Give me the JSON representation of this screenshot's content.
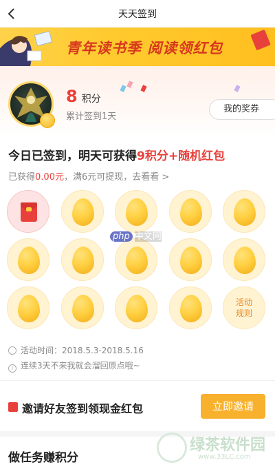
{
  "header": {
    "title": "天天签到"
  },
  "banner": {
    "text": "青年读书季 阅读领红包"
  },
  "profile": {
    "points": "8",
    "points_unit": "积分",
    "streak_text": "累计签到1天",
    "my_rewards_label": "我的奖券"
  },
  "today": {
    "prefix": "今日已签到，明天可获得",
    "reward": "9积分+随机红包",
    "earned_prefix": "已获得",
    "earned_amount": "0.00元",
    "earned_suffix": "，满6元可提现，去看看 >"
  },
  "checkin_grid": {
    "rules_label": "活动规则",
    "days": [
      {
        "state": "signed"
      },
      {
        "state": "egg"
      },
      {
        "state": "egg"
      },
      {
        "state": "egg"
      },
      {
        "state": "egg"
      },
      {
        "state": "egg"
      },
      {
        "state": "egg"
      },
      {
        "state": "egg"
      },
      {
        "state": "egg"
      },
      {
        "state": "egg"
      },
      {
        "state": "egg"
      },
      {
        "state": "egg"
      },
      {
        "state": "egg"
      },
      {
        "state": "egg"
      }
    ]
  },
  "info": {
    "activity_time": "活动时间：2018.5.3-2018.5.16",
    "notice": "连续3天不来我就会溜回原点哦~"
  },
  "invite": {
    "label": "邀请好友签到领现金红包",
    "button": "立即邀请"
  },
  "tasks": {
    "title": "做任务赚积分"
  },
  "watermarks": {
    "php_logo": "php",
    "php_text": "中文网",
    "site_name": "绿茶软件园",
    "site_url": "www.33LC.com"
  },
  "colors": {
    "accent_red": "#e8403b",
    "accent_orange": "#f8b12c",
    "egg_gold": "#ffd042"
  }
}
